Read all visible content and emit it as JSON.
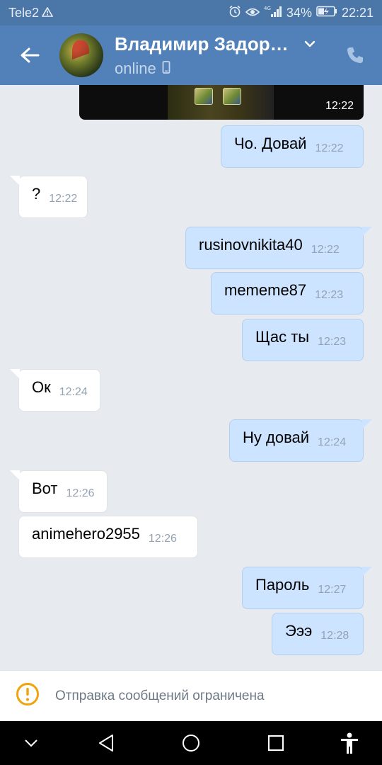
{
  "status_bar": {
    "carrier": "Tele2",
    "battery": "34%",
    "time": "22:21"
  },
  "header": {
    "contact_name": "Владимир Задоро…",
    "presence": "online",
    "icons": [
      "back-arrow-icon",
      "chevron-down-icon",
      "phone-icon",
      "mobile-device-icon"
    ]
  },
  "media_message": {
    "time": "12:22"
  },
  "messages": [
    {
      "direction": "out",
      "text": "Чо. Довай",
      "time": "12:22"
    },
    {
      "direction": "in",
      "text": "?",
      "time": "12:22"
    },
    {
      "direction": "out",
      "text": "rusinovnikita40",
      "time": "12:22"
    },
    {
      "direction": "out",
      "text": "mememe87",
      "time": "12:23"
    },
    {
      "direction": "out",
      "text": "Щас ты",
      "time": "12:23"
    },
    {
      "direction": "in",
      "text": "Ок",
      "time": "12:24"
    },
    {
      "direction": "out",
      "text": "Ну довай",
      "time": "12:24"
    },
    {
      "direction": "in",
      "text": "Вот",
      "time": "12:26"
    },
    {
      "direction": "in",
      "text": "animehero2955",
      "time": "12:26"
    },
    {
      "direction": "out",
      "text": "Пароль",
      "time": "12:27"
    },
    {
      "direction": "out",
      "text": "Эээ",
      "time": "12:28"
    }
  ],
  "restriction": {
    "text": "Отправка сообщений ограничена",
    "icon": "warning-circle-icon",
    "icon_color": "#f0a30a"
  },
  "nav_bar": {
    "icons": [
      "chevron-down-icon",
      "back-triangle-icon",
      "home-circle-icon",
      "recents-square-icon",
      "accessibility-icon"
    ]
  },
  "colors": {
    "header": "#5181b8",
    "status_bar": "#4a76a8",
    "outgoing_bubble": "#cce4ff",
    "incoming_bubble": "#ffffff",
    "background": "#e7ebf0"
  }
}
